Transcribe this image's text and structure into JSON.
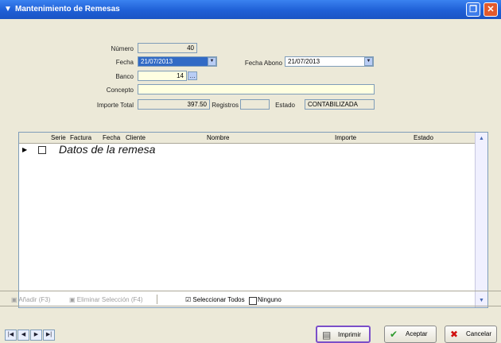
{
  "window": {
    "title": "Mantenimiento de Remesas",
    "title_icon": "funnel-icon"
  },
  "form": {
    "numero_label": "Número",
    "numero_value": "40",
    "fecha_label": "Fecha",
    "fecha_value": "21/07/2013",
    "fecha_abono_label": "Fecha Abono",
    "fecha_abono_value": "21/07/2013",
    "banco_label": "Banco",
    "banco_value": "14",
    "concepto_label": "Concepto",
    "concepto_value": "",
    "importe_total_label": "Importe Total",
    "importe_total_value": "397.50",
    "registros_label": "Registros",
    "registros_value": "",
    "estado_label": "Estado",
    "estado_value": "CONTABILIZADA"
  },
  "grid": {
    "columns": [
      "Serie",
      "Factura",
      "Fecha",
      "Cliente",
      "Nombre",
      "Importe",
      "Estado"
    ],
    "row_note": "Datos de la remesa"
  },
  "toolbar": {
    "btn1": "Añadir (F3)",
    "btn2": "Eliminar Selección (F4)",
    "select_all": "Seleccionar Todos",
    "none": "Ninguno"
  },
  "buttons": {
    "print": "Imprimir",
    "accept": "Aceptar",
    "cancel": "Cancelar"
  },
  "colors": {
    "titlebar": "#1f5fd6",
    "print_highlight": "#7b4fc9",
    "accept": "#2e9a2e",
    "cancel": "#d01010"
  }
}
